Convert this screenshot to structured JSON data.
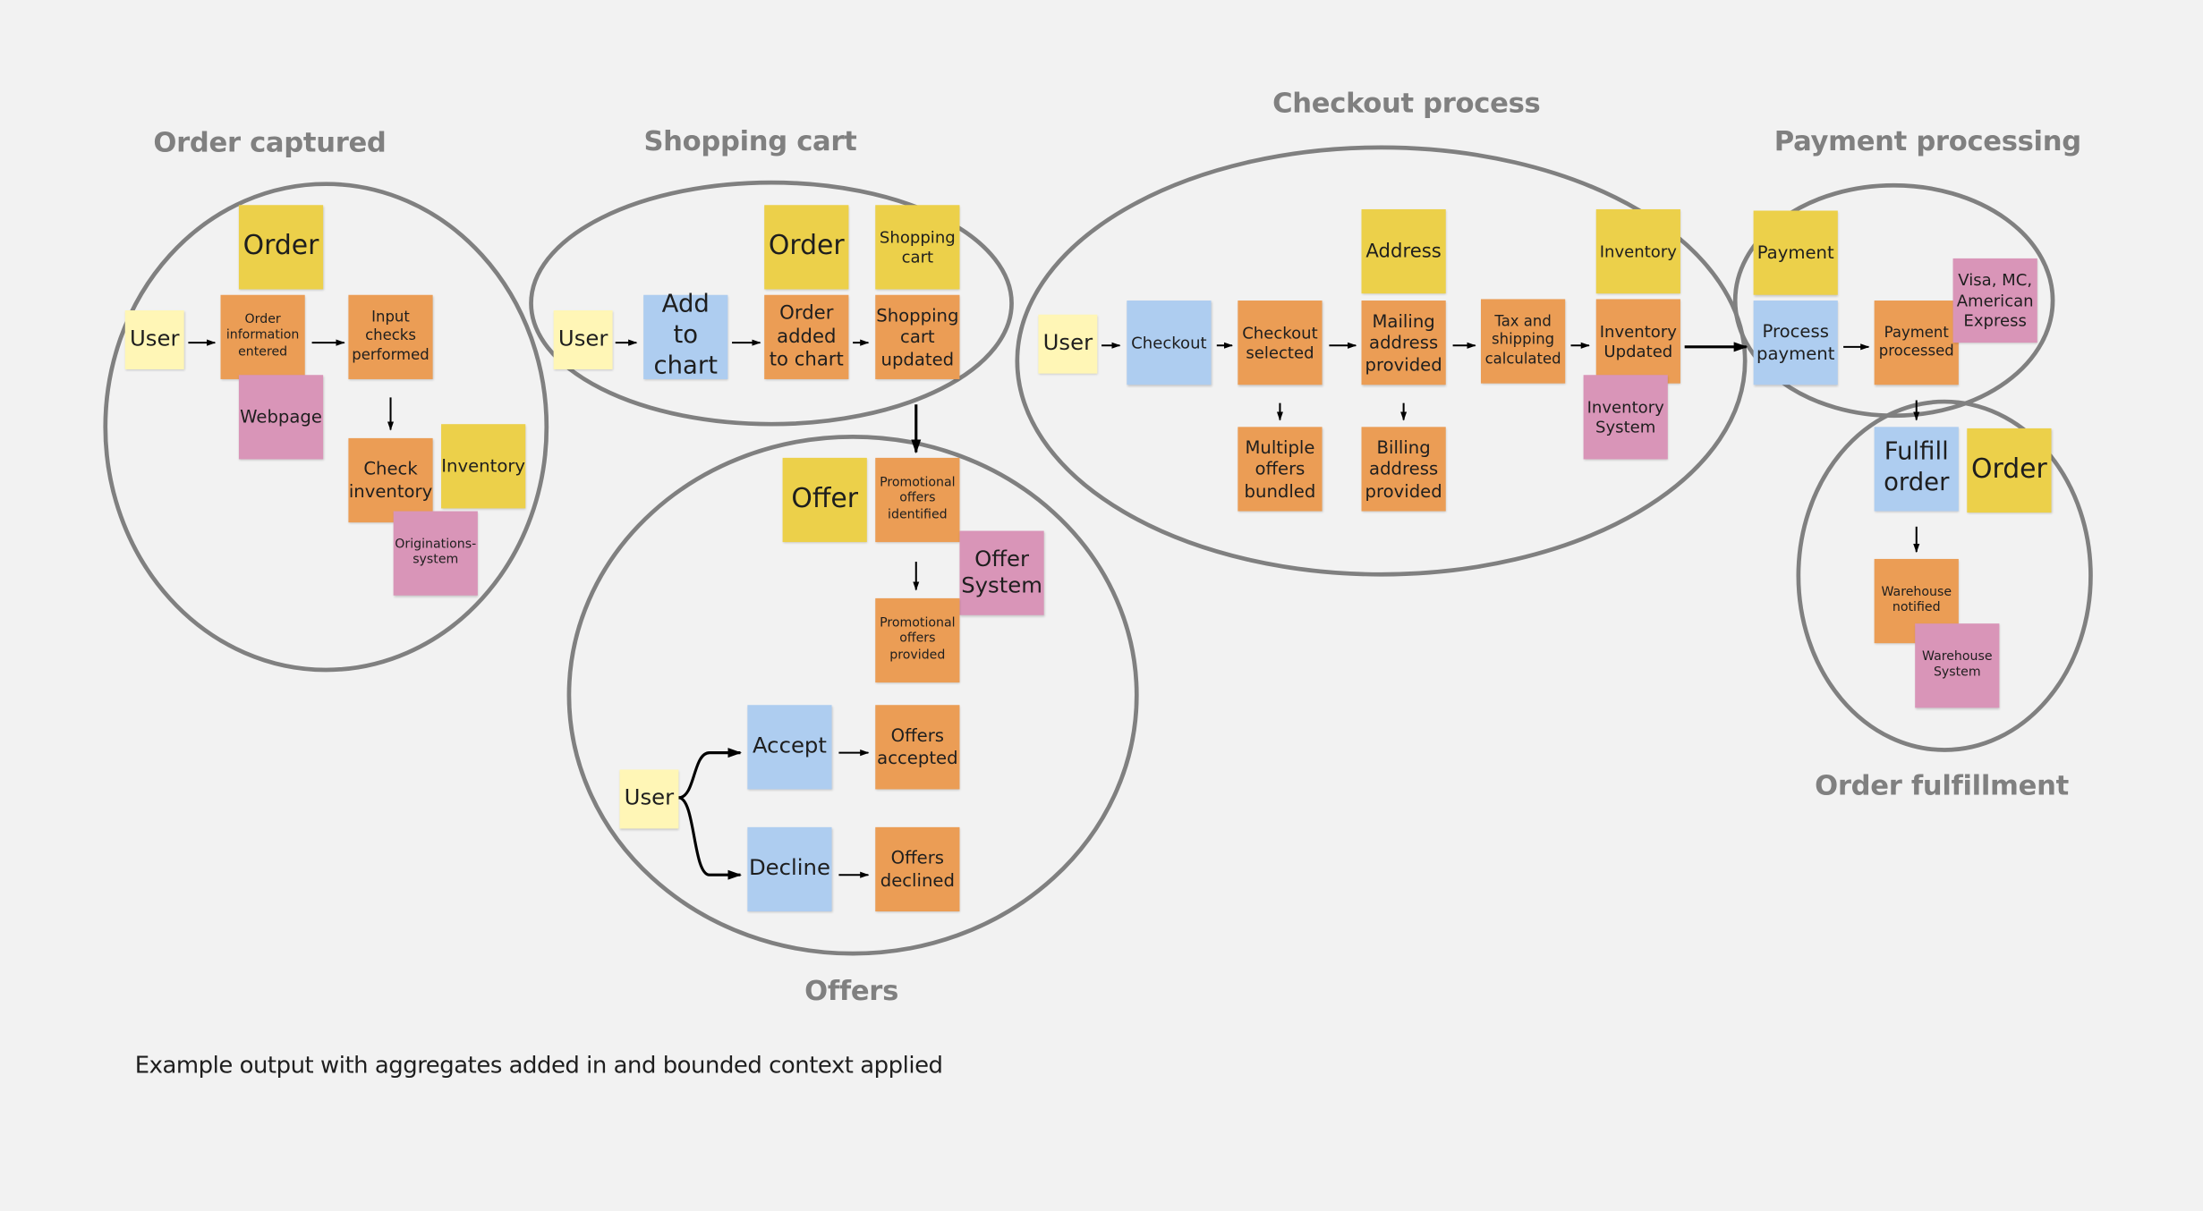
{
  "contexts": [
    {
      "id": "order-captured",
      "title": "Order captured"
    },
    {
      "id": "shopping-cart",
      "title": "Shopping cart"
    },
    {
      "id": "checkout-process",
      "title": "Checkout process"
    },
    {
      "id": "payment-processing",
      "title": "Payment processing"
    },
    {
      "id": "offers",
      "title": "Offers"
    },
    {
      "id": "order-fulfillment",
      "title": "Order fulfillment"
    }
  ],
  "legend_colors": {
    "actor": "#fff6b6",
    "domain_event": "#eb9d55",
    "aggregate": "#ecd04a",
    "command": "#aecdf0",
    "external_system": "#d995b8",
    "boundary": "#808080"
  },
  "notes": {
    "order_captured": {
      "user": "User",
      "order_aggregate": "Order",
      "order_information_entered": "Order information entered",
      "input_checks_performed": "Input checks performed",
      "webpage": "Webpage",
      "check_inventory": "Check inventory",
      "inventory_aggregate": "Inventory",
      "originations_system": "Originations-system"
    },
    "shopping_cart": {
      "user": "User",
      "add_to_chart": "Add to chart",
      "order_aggregate": "Order",
      "order_added_to_chart": "Order added to chart",
      "shopping_cart_aggregate": "Shopping cart",
      "shopping_cart_updated": "Shopping cart updated"
    },
    "offers": {
      "offer_aggregate": "Offer",
      "promotional_offers_identified": "Promotional offers identified",
      "offer_system": "Offer System",
      "promotional_offers_provided": "Promotional offers provided",
      "user": "User",
      "accept": "Accept",
      "offers_accepted": "Offers accepted",
      "decline": "Decline",
      "offers_declined": "Offers declined"
    },
    "checkout": {
      "user": "User",
      "checkout": "Checkout",
      "checkout_selected": "Checkout selected",
      "multiple_offers_bundled": "Multiple offers bundled",
      "address_aggregate": "Address",
      "mailing_address_provided": "Mailing address provided",
      "billing_address_provided": "Billing address provided",
      "tax_and_shipping_calculated": "Tax and shipping calculated",
      "inventory_aggregate": "Inventory",
      "inventory_updated": "Inventory Updated",
      "inventory_system": "Inventory System"
    },
    "payment": {
      "payment_aggregate": "Payment",
      "process_payment": "Process payment",
      "payment_processed": "Payment processed",
      "card_networks": "Visa, MC, American Express"
    },
    "fulfillment": {
      "fulfill_order": "Fulfill order",
      "order_aggregate": "Order",
      "warehouse_notified": "Warehouse notified",
      "warehouse_system": "Warehouse System"
    }
  },
  "caption": "Example output with aggregates added in and bounded context applied"
}
